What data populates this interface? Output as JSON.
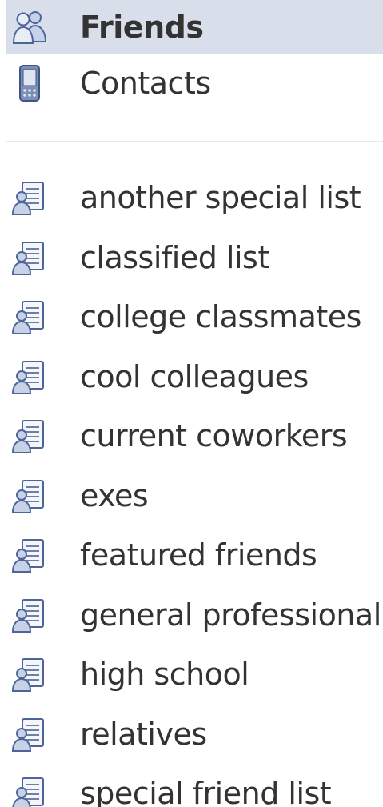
{
  "nav": {
    "primary": [
      {
        "label": "Friends",
        "icon": "friends-icon",
        "selected": true
      },
      {
        "label": "Contacts",
        "icon": "phone-icon",
        "selected": false
      }
    ],
    "lists": [
      {
        "label": "another special list"
      },
      {
        "label": "classified list"
      },
      {
        "label": "college classmates"
      },
      {
        "label": "cool colleagues"
      },
      {
        "label": "current coworkers"
      },
      {
        "label": "exes"
      },
      {
        "label": "featured friends"
      },
      {
        "label": "general professional"
      },
      {
        "label": "high school"
      },
      {
        "label": "relatives"
      },
      {
        "label": "special friend list"
      }
    ],
    "list_icon": "friend-list-icon"
  },
  "colors": {
    "selected_bg": "#d8dfea",
    "text": "#333333",
    "icon_blue": "#5b73a8"
  }
}
